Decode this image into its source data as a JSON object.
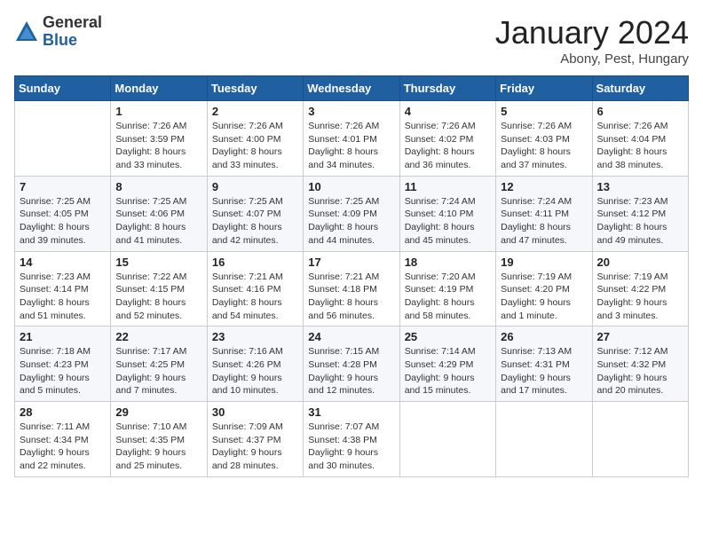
{
  "logo": {
    "general": "General",
    "blue": "Blue"
  },
  "title": "January 2024",
  "location": "Abony, Pest, Hungary",
  "days_of_week": [
    "Sunday",
    "Monday",
    "Tuesday",
    "Wednesday",
    "Thursday",
    "Friday",
    "Saturday"
  ],
  "weeks": [
    [
      {
        "num": "",
        "info": ""
      },
      {
        "num": "1",
        "info": "Sunrise: 7:26 AM\nSunset: 3:59 PM\nDaylight: 8 hours\nand 33 minutes."
      },
      {
        "num": "2",
        "info": "Sunrise: 7:26 AM\nSunset: 4:00 PM\nDaylight: 8 hours\nand 33 minutes."
      },
      {
        "num": "3",
        "info": "Sunrise: 7:26 AM\nSunset: 4:01 PM\nDaylight: 8 hours\nand 34 minutes."
      },
      {
        "num": "4",
        "info": "Sunrise: 7:26 AM\nSunset: 4:02 PM\nDaylight: 8 hours\nand 36 minutes."
      },
      {
        "num": "5",
        "info": "Sunrise: 7:26 AM\nSunset: 4:03 PM\nDaylight: 8 hours\nand 37 minutes."
      },
      {
        "num": "6",
        "info": "Sunrise: 7:26 AM\nSunset: 4:04 PM\nDaylight: 8 hours\nand 38 minutes."
      }
    ],
    [
      {
        "num": "7",
        "info": "Sunrise: 7:25 AM\nSunset: 4:05 PM\nDaylight: 8 hours\nand 39 minutes."
      },
      {
        "num": "8",
        "info": "Sunrise: 7:25 AM\nSunset: 4:06 PM\nDaylight: 8 hours\nand 41 minutes."
      },
      {
        "num": "9",
        "info": "Sunrise: 7:25 AM\nSunset: 4:07 PM\nDaylight: 8 hours\nand 42 minutes."
      },
      {
        "num": "10",
        "info": "Sunrise: 7:25 AM\nSunset: 4:09 PM\nDaylight: 8 hours\nand 44 minutes."
      },
      {
        "num": "11",
        "info": "Sunrise: 7:24 AM\nSunset: 4:10 PM\nDaylight: 8 hours\nand 45 minutes."
      },
      {
        "num": "12",
        "info": "Sunrise: 7:24 AM\nSunset: 4:11 PM\nDaylight: 8 hours\nand 47 minutes."
      },
      {
        "num": "13",
        "info": "Sunrise: 7:23 AM\nSunset: 4:12 PM\nDaylight: 8 hours\nand 49 minutes."
      }
    ],
    [
      {
        "num": "14",
        "info": "Sunrise: 7:23 AM\nSunset: 4:14 PM\nDaylight: 8 hours\nand 51 minutes."
      },
      {
        "num": "15",
        "info": "Sunrise: 7:22 AM\nSunset: 4:15 PM\nDaylight: 8 hours\nand 52 minutes."
      },
      {
        "num": "16",
        "info": "Sunrise: 7:21 AM\nSunset: 4:16 PM\nDaylight: 8 hours\nand 54 minutes."
      },
      {
        "num": "17",
        "info": "Sunrise: 7:21 AM\nSunset: 4:18 PM\nDaylight: 8 hours\nand 56 minutes."
      },
      {
        "num": "18",
        "info": "Sunrise: 7:20 AM\nSunset: 4:19 PM\nDaylight: 8 hours\nand 58 minutes."
      },
      {
        "num": "19",
        "info": "Sunrise: 7:19 AM\nSunset: 4:20 PM\nDaylight: 9 hours\nand 1 minute."
      },
      {
        "num": "20",
        "info": "Sunrise: 7:19 AM\nSunset: 4:22 PM\nDaylight: 9 hours\nand 3 minutes."
      }
    ],
    [
      {
        "num": "21",
        "info": "Sunrise: 7:18 AM\nSunset: 4:23 PM\nDaylight: 9 hours\nand 5 minutes."
      },
      {
        "num": "22",
        "info": "Sunrise: 7:17 AM\nSunset: 4:25 PM\nDaylight: 9 hours\nand 7 minutes."
      },
      {
        "num": "23",
        "info": "Sunrise: 7:16 AM\nSunset: 4:26 PM\nDaylight: 9 hours\nand 10 minutes."
      },
      {
        "num": "24",
        "info": "Sunrise: 7:15 AM\nSunset: 4:28 PM\nDaylight: 9 hours\nand 12 minutes."
      },
      {
        "num": "25",
        "info": "Sunrise: 7:14 AM\nSunset: 4:29 PM\nDaylight: 9 hours\nand 15 minutes."
      },
      {
        "num": "26",
        "info": "Sunrise: 7:13 AM\nSunset: 4:31 PM\nDaylight: 9 hours\nand 17 minutes."
      },
      {
        "num": "27",
        "info": "Sunrise: 7:12 AM\nSunset: 4:32 PM\nDaylight: 9 hours\nand 20 minutes."
      }
    ],
    [
      {
        "num": "28",
        "info": "Sunrise: 7:11 AM\nSunset: 4:34 PM\nDaylight: 9 hours\nand 22 minutes."
      },
      {
        "num": "29",
        "info": "Sunrise: 7:10 AM\nSunset: 4:35 PM\nDaylight: 9 hours\nand 25 minutes."
      },
      {
        "num": "30",
        "info": "Sunrise: 7:09 AM\nSunset: 4:37 PM\nDaylight: 9 hours\nand 28 minutes."
      },
      {
        "num": "31",
        "info": "Sunrise: 7:07 AM\nSunset: 4:38 PM\nDaylight: 9 hours\nand 30 minutes."
      },
      {
        "num": "",
        "info": ""
      },
      {
        "num": "",
        "info": ""
      },
      {
        "num": "",
        "info": ""
      }
    ]
  ]
}
